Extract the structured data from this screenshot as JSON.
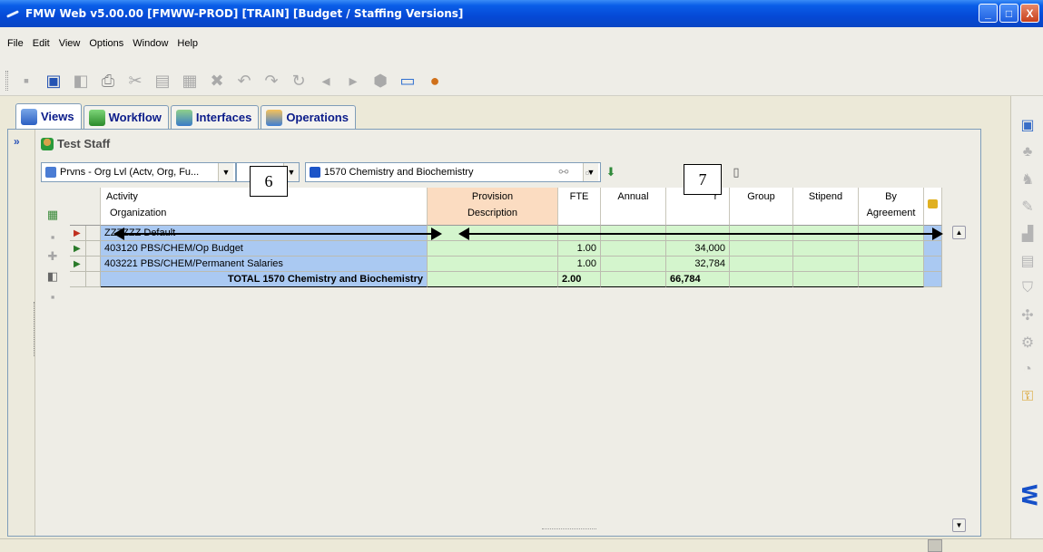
{
  "window": {
    "title": "FMW Web v5.00.00 [FMWW-PROD] [TRAIN] [Budget / Staffing Versions]",
    "buttons": {
      "minimize": "_",
      "maximize": "□",
      "close": "X"
    }
  },
  "menu": [
    "File",
    "Edit",
    "View",
    "Options",
    "Window",
    "Help"
  ],
  "toolbar_icons": [
    "new-icon",
    "save-icon",
    "copy-icon",
    "print-icon",
    "cut-icon",
    "paste-icon",
    "clipboard-icon",
    "delete-icon",
    "undo-icon",
    "redo-icon",
    "refresh-icon",
    "back-icon",
    "forward-icon",
    "lock-icon",
    "window-icon",
    "user-icon"
  ],
  "tabs": [
    {
      "label": "Views",
      "active": true
    },
    {
      "label": "Workflow",
      "active": false
    },
    {
      "label": "Interfaces",
      "active": false
    },
    {
      "label": "Operations",
      "active": false
    }
  ],
  "breadcrumb": "Test Staff",
  "filters": {
    "view_select": "Prvns - Org Lvl (Actv, Org, Fu...",
    "org_select": "1570  Chemistry and Biochemistry"
  },
  "callouts": {
    "a": "6",
    "b": "7"
  },
  "columns": {
    "activity": {
      "line1": "Activity",
      "line2": "Organization"
    },
    "provision": {
      "line1": "Provision",
      "line2": "Description"
    },
    "fte": "FTE",
    "annual": "Annual",
    "salary": "r",
    "group": "Group",
    "stipend": "Stipend",
    "by_agreement": {
      "line1": "By",
      "line2": "Agreement"
    }
  },
  "rows": [
    {
      "activity": "ZZZZZZ    Default",
      "fte": "",
      "salary": ""
    },
    {
      "activity": "403120  PBS/CHEM/Op Budget",
      "fte": "1.00",
      "salary": "34,000"
    },
    {
      "activity": "403221  PBS/CHEM/Permanent Salaries",
      "fte": "1.00",
      "salary": "32,784"
    }
  ],
  "total": {
    "label": "TOTAL 1570  Chemistry and Biochemistry",
    "fte": "2.00",
    "salary": "66,784"
  },
  "brand": "FMW W",
  "colors": {
    "row_blue": "#aac9f2",
    "row_green": "#d4f5cd",
    "provision_header": "#fbdcc1",
    "title_blue": "#0549d6"
  }
}
